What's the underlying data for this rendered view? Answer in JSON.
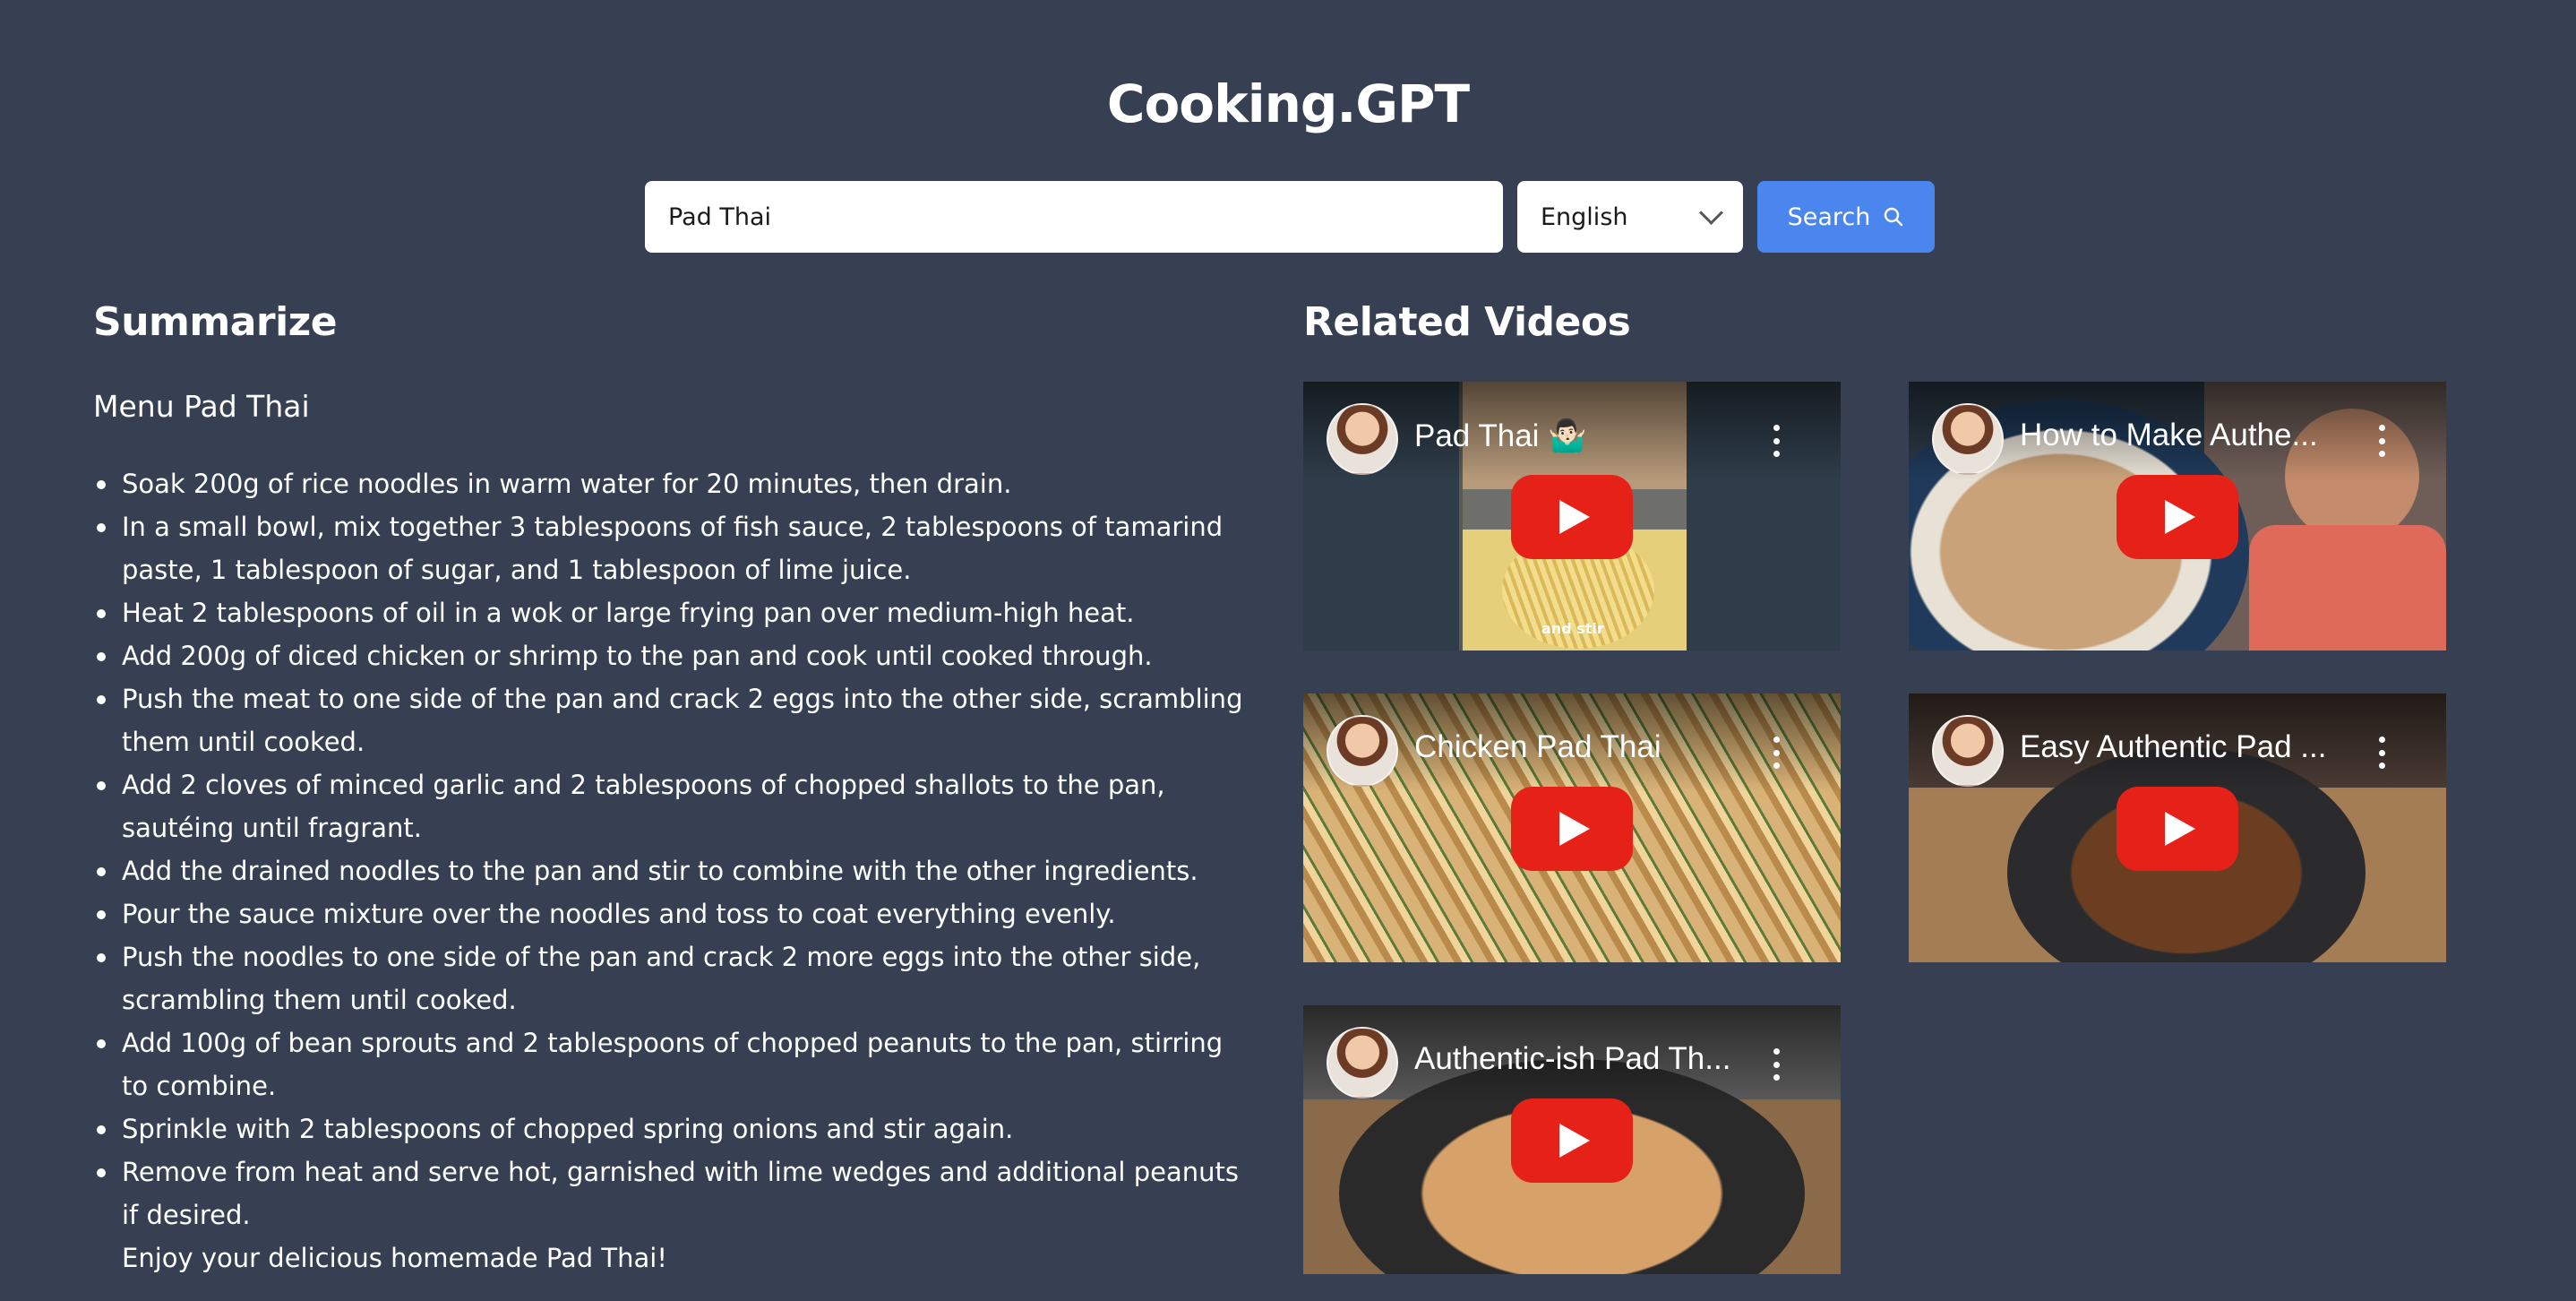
{
  "app": {
    "title": "Cooking.GPT"
  },
  "search": {
    "value": "Pad Thai",
    "placeholder": "",
    "button_label": "Search"
  },
  "language": {
    "selected": "English"
  },
  "summary": {
    "heading": "Summarize",
    "menu_title": "Menu Pad Thai",
    "steps": [
      "Soak 200g of rice noodles in warm water for 20 minutes, then drain.",
      "In a small bowl, mix together 3 tablespoons of fish sauce, 2 tablespoons of tamarind paste, 1 tablespoon of sugar, and 1 tablespoon of lime juice.",
      "Heat 2 tablespoons of oil in a wok or large frying pan over medium-high heat.",
      "Add 200g of diced chicken or shrimp to the pan and cook until cooked through.",
      "Push the meat to one side of the pan and crack 2 eggs into the other side, scrambling them until cooked.",
      "Add 2 cloves of minced garlic and 2 tablespoons of chopped shallots to the pan, sautéing until fragrant.",
      "Add the drained noodles to the pan and stir to combine with the other ingredients.",
      "Pour the sauce mixture over the noodles and toss to coat everything evenly.",
      "Push the noodles to one side of the pan and crack 2 more eggs into the other side, scrambling them until cooked.",
      "Add 100g of bean sprouts and 2 tablespoons of chopped peanuts to the pan, stirring to combine.",
      "Sprinkle with 2 tablespoons of chopped spring onions and stir again.",
      "Remove from heat and serve hot, garnished with lime wedges and additional peanuts if desired."
    ],
    "closing": "Enjoy your delicious homemade Pad Thai!"
  },
  "videos": {
    "heading": "Related Videos",
    "items": [
      {
        "title": "Pad Thai 🤷🏻‍♂️",
        "caption": "and stir"
      },
      {
        "title": "How to Make Authe..."
      },
      {
        "title": "Chicken Pad Thai"
      },
      {
        "title": "Easy Authentic Pad ..."
      },
      {
        "title": "Authentic-ish Pad Th..."
      }
    ]
  },
  "colors": {
    "background": "#364052",
    "accent": "#4a86ee",
    "play": "#e62117"
  },
  "icons": {
    "search_button": "search-icon",
    "select": "chevron-down-icon",
    "video_play": "play-icon",
    "video_menu": "more-vert-icon"
  }
}
